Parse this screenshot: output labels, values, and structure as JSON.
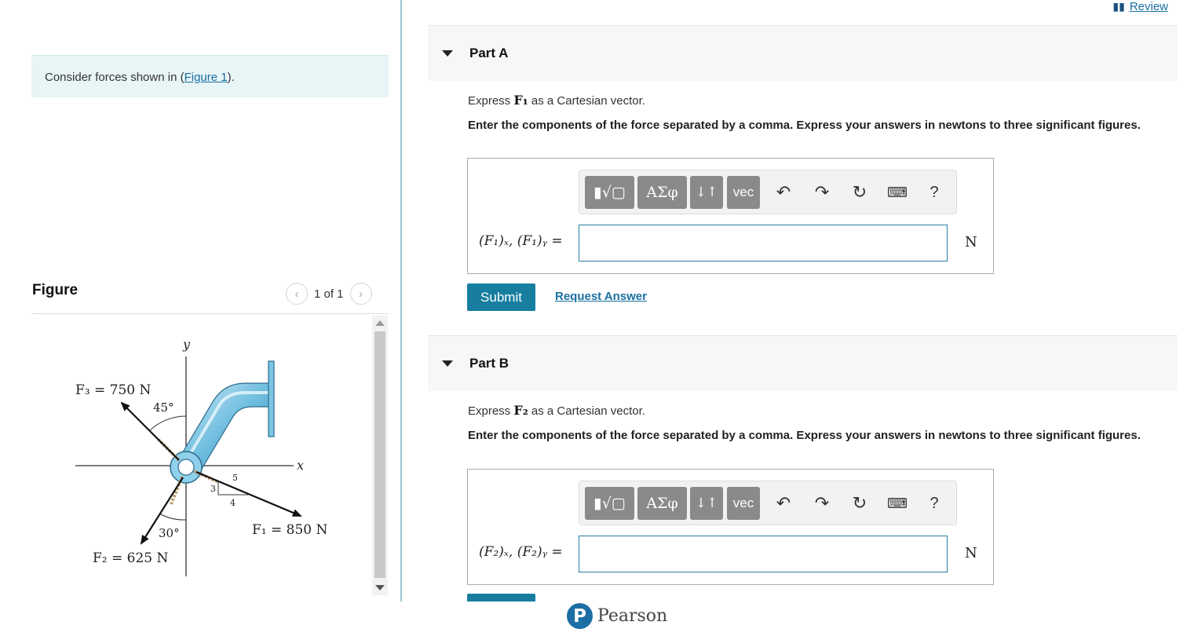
{
  "review": {
    "label": "Review",
    "icon": "book-icon"
  },
  "intro": {
    "prefix": "Consider forces shown in (",
    "link": "Figure 1",
    "suffix": ")."
  },
  "figure": {
    "title": "Figure",
    "pager": "1 of 1",
    "labels": {
      "y_axis": "y",
      "x_axis": "x",
      "f3": "F₃ = 750 N",
      "f3_angle": "45°",
      "f1": "F₁ = 850 N",
      "f2": "F₂ = 625 N",
      "f2_angle": "30°",
      "tri_3": "3",
      "tri_4": "4",
      "tri_5": "5"
    }
  },
  "parts": [
    {
      "title": "Part A",
      "question_pre": "Express ",
      "question_vec": "F₁",
      "question_post": " as a Cartesian vector.",
      "instructions": "Enter the components of the force separated by a comma. Express your answers in newtons to three significant figures.",
      "answer_label": "(F₁)ₓ, (F₁)ᵧ =",
      "unit": "N",
      "submit": "Submit",
      "request": "Request Answer"
    },
    {
      "title": "Part B",
      "question_pre": "Express ",
      "question_vec": "F₂",
      "question_post": " as a Cartesian vector.",
      "instructions": "Enter the components of the force separated by a comma. Express your answers in newtons to three significant figures.",
      "answer_label": "(F₂)ₓ, (F₂)ᵧ =",
      "unit": "N"
    }
  ],
  "toolbar": {
    "greek": "ΑΣφ",
    "arrows": "↓↑",
    "vec": "vec",
    "help": "?"
  },
  "brand": {
    "name": "Pearson",
    "logo_letter": "P"
  }
}
